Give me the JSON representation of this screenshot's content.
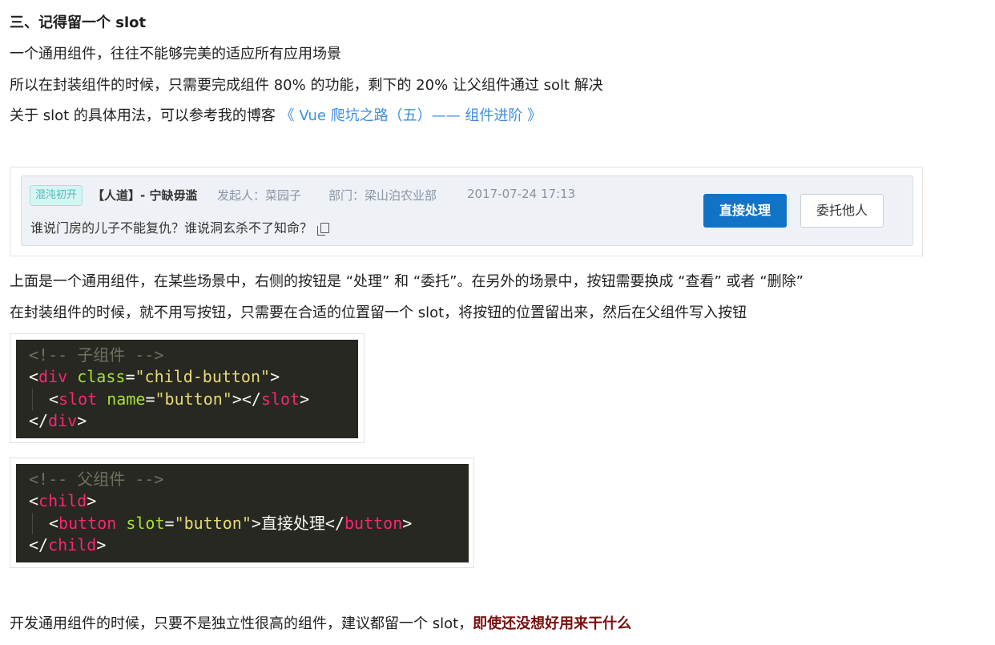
{
  "section": {
    "heading": "三、记得留一个 slot",
    "p1": "一个通用组件，往往不能够完美的适应所有应用场景",
    "p2": "所以在封装组件的时候，只需要完成组件 80% 的功能，剩下的 20% 让父组件通过 solt 解决",
    "p3_prefix": "关于 slot 的具体用法，可以参考我的博客 ",
    "p3_link": "《 Vue 爬坑之路（五）—— 组件进阶 》",
    "p4": "上面是一个通用组件，在某些场景中，右侧的按钮是 “处理” 和 “委托”。在另外的场景中，按钮需要换成 “查看” 或者 “删除”",
    "p5": "在封装组件的时候，就不用写按钮，只需要在合适的位置留一个 slot，将按钮的位置留出来，然后在父组件写入按钮",
    "p6_prefix": "开发通用组件的时候，只要不是独立性很高的组件，建议都留一个 slot，",
    "p6_strong": "即使还没想好用来干什么"
  },
  "card": {
    "tag": "混沌初开",
    "title": "【人道】- 宁缺毋滥",
    "initiator": "发起人：菜园子",
    "department": "部门：梁山泊农业部",
    "datetime": "2017-07-24 17:13",
    "description": "谁说门房的儿子不能复仇？谁说洞玄杀不了知命？",
    "primary_button": "直接处理",
    "secondary_button": "委托他人",
    "colors": {
      "primary": "#1173c6",
      "tag_text": "#4fb7bb"
    }
  },
  "code_child": {
    "comment": "<!-- 子组件 -->",
    "l2_open": "<",
    "l2_tag": "div",
    "l2_attr": "class",
    "l2_eq": "=",
    "l2_val": "\"child-button\"",
    "l2_close": ">",
    "l3_open": "<",
    "l3_tag": "slot",
    "l3_attr": "name",
    "l3_eq": "=",
    "l3_val": "\"button\"",
    "l3_mid": "></",
    "l3_tag2": "slot",
    "l3_close": ">",
    "l4_open": "</",
    "l4_tag": "div",
    "l4_close": ">"
  },
  "code_parent": {
    "comment": "<!-- 父组件 -->",
    "l2_open": "<",
    "l2_tag": "child",
    "l2_close": ">",
    "l3_open": "<",
    "l3_tag": "button",
    "l3_attr": "slot",
    "l3_eq": "=",
    "l3_val": "\"button\"",
    "l3_text": ">直接处理</",
    "l3_tag2": "button",
    "l3_close": ">",
    "l4_open": "</",
    "l4_tag": "child",
    "l4_close": ">"
  }
}
